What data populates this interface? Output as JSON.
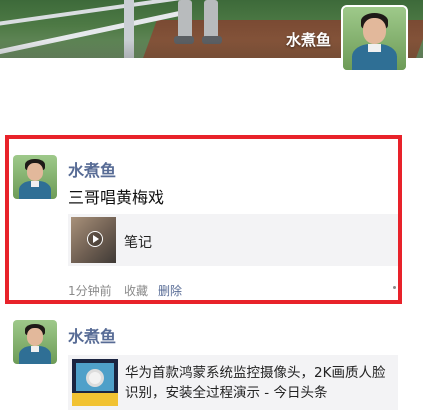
{
  "profile": {
    "name": "水煮鱼"
  },
  "posts": [
    {
      "author": "水煮鱼",
      "text": "三哥唱黄梅戏",
      "link": {
        "title": "笔记"
      },
      "meta": {
        "time": "1分钟前",
        "favorite": "收藏",
        "delete": "删除"
      }
    },
    {
      "author": "水煮鱼",
      "link": {
        "title": "华为首款鸿蒙系统监控摄像头，2K画质人脸识别，安装全过程演示 - 今日头条"
      }
    }
  ],
  "colors": {
    "name_link": "#576b95",
    "highlight_border": "#e8222a",
    "card_bg": "#f3f3f5"
  }
}
